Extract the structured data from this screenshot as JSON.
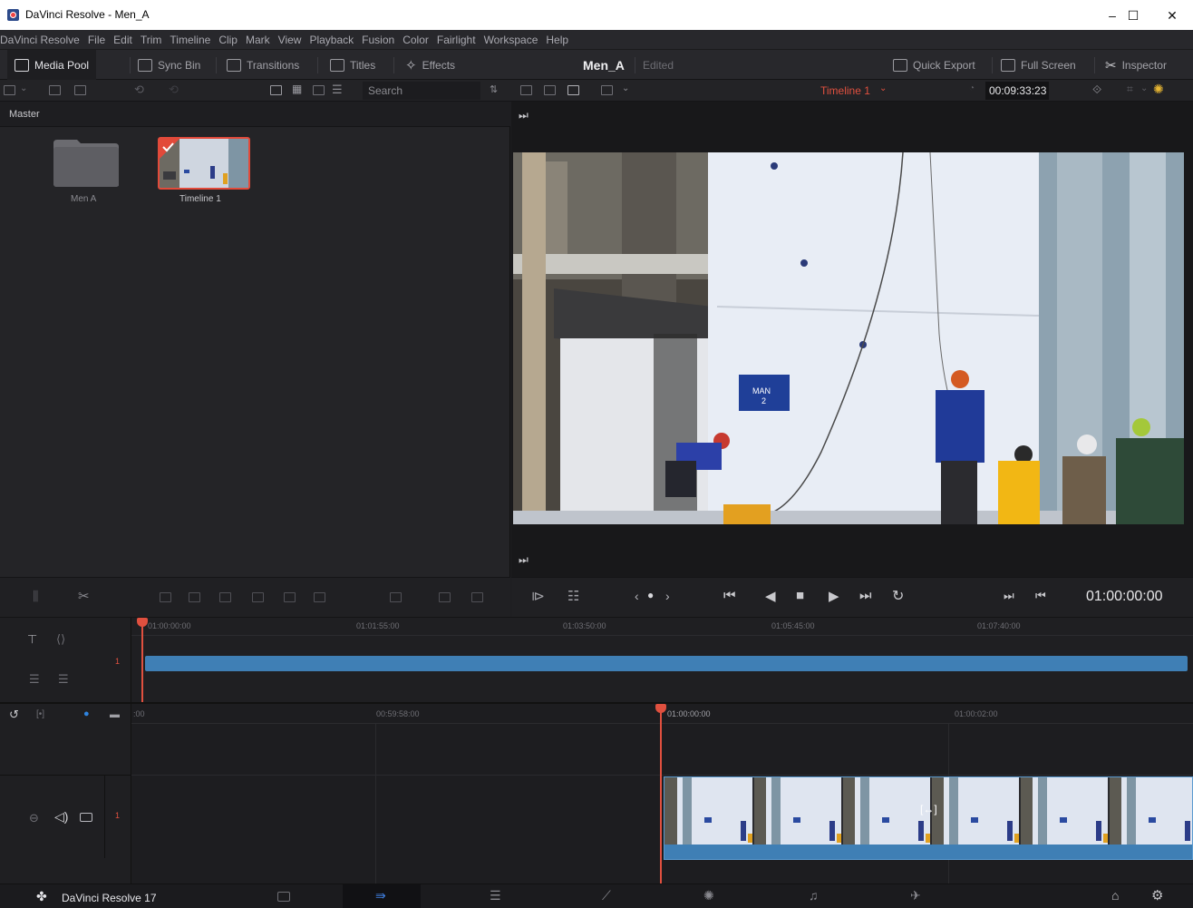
{
  "window": {
    "title": "DaVinci Resolve - Men_A"
  },
  "menu": [
    "DaVinci Resolve",
    "File",
    "Edit",
    "Trim",
    "Timeline",
    "Clip",
    "Mark",
    "View",
    "Playback",
    "Fusion",
    "Color",
    "Fairlight",
    "Workspace",
    "Help"
  ],
  "toolbar": {
    "media_pool": "Media Pool",
    "sync_bin": "Sync Bin",
    "transitions": "Transitions",
    "titles": "Titles",
    "effects": "Effects",
    "project_name": "Men_A",
    "project_status": "Edited",
    "quick_export": "Quick Export",
    "full_screen": "Full Screen",
    "inspector": "Inspector"
  },
  "subbar": {
    "search_placeholder": "Search",
    "timeline_name": "Timeline 1",
    "timecode": "00:09:33:23"
  },
  "media_pool": {
    "bin": "Master",
    "items": [
      {
        "label": "Men A",
        "kind": "folder"
      },
      {
        "label": "Timeline 1",
        "kind": "timeline"
      }
    ]
  },
  "viewer": {
    "sign_text_line1": "MAN",
    "sign_text_line2": "2"
  },
  "transport": {
    "current_timecode": "01:00:00:00"
  },
  "upper_ruler": [
    "01:00:00:00",
    "01:01:55:00",
    "01:03:50:00",
    "01:05:45:00",
    "01:07:40:00"
  ],
  "lower_ruler": [
    ":00",
    "00:59:58:00",
    "01:00:00:00",
    "01:00:02:00"
  ],
  "tracks": {
    "upper_track_number": "1",
    "lower_track_number": "1"
  },
  "pagebar": {
    "app_version": "DaVinci Resolve 17"
  },
  "colors": {
    "accent_red": "#e24a3a",
    "clip_blue": "#3f7fb5",
    "timeline_red": "#e0503f"
  }
}
